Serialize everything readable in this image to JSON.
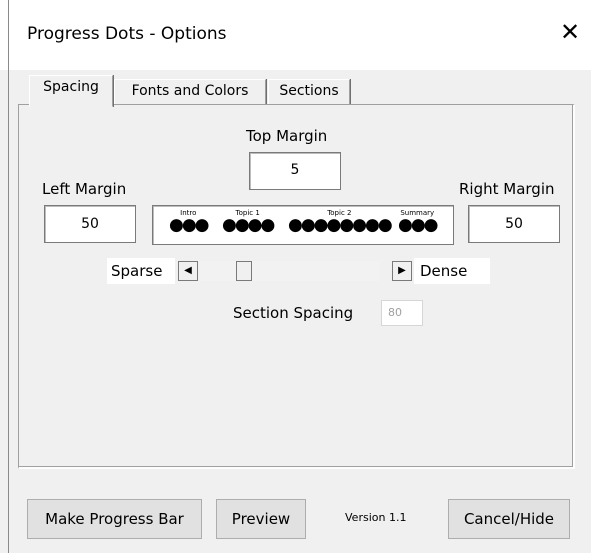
{
  "window": {
    "title": "Progress Dots - Options",
    "close_glyph": "✕"
  },
  "tabs": [
    {
      "label": "Spacing",
      "active": true
    },
    {
      "label": "Fonts and Colors",
      "active": false
    },
    {
      "label": "Sections",
      "active": false
    }
  ],
  "spacing": {
    "top_margin_label": "Top Margin",
    "top_margin_value": "5",
    "left_margin_label": "Left Margin",
    "left_margin_value": "50",
    "right_margin_label": "Right Margin",
    "right_margin_value": "50",
    "preview_sections": [
      {
        "name": "Intro",
        "dots": "●●●"
      },
      {
        "name": "Topic 1",
        "dots": "●●●●"
      },
      {
        "name": "Topic 2",
        "dots": "●●●●●●●●"
      },
      {
        "name": "Summary",
        "dots": "●●●"
      }
    ],
    "sparse_label": "Sparse",
    "dense_label": "Dense",
    "slider_position_fraction": 0.22,
    "section_spacing_label": "Section Spacing",
    "section_spacing_value": "80"
  },
  "footer": {
    "make_button": "Make Progress Bar",
    "preview_button": "Preview",
    "version": "Version 1.1",
    "cancel_button": "Cancel/Hide"
  }
}
